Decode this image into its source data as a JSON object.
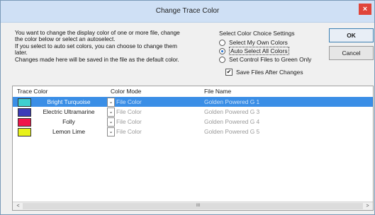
{
  "window": {
    "title": "Change Trace Color",
    "close_label": "×"
  },
  "instructions": [
    "You want to change the display color of one or more file, change",
    "the color below or select an autoselect.",
    "If you select to auto set colors, you can choose to change them",
    "later.",
    "Changes made here will be saved in the file as the default color."
  ],
  "settings": {
    "heading": "Select Color Choice Settings",
    "options": [
      {
        "label": "Select My Own Colors",
        "selected": false
      },
      {
        "label": "Auto Select All Colors",
        "selected": true
      },
      {
        "label": "Set Control Files to Green Only",
        "selected": false
      }
    ],
    "save_files_label": "Save Files After Changes",
    "save_files_checked": true
  },
  "buttons": {
    "ok": "OK",
    "cancel": "Cancel"
  },
  "table": {
    "headers": {
      "color": "Trace Color",
      "mode": "Color Mode",
      "file": "File Name"
    },
    "rows": [
      {
        "color_name": "Bright Turquoise",
        "swatch": "#3fd0cf",
        "mode": "File Color",
        "file": "Golden Powered G 1",
        "selected": true
      },
      {
        "color_name": "Electric Ultramarine",
        "swatch": "#3b3bb8",
        "mode": "File Color",
        "file": "Golden Powered G 3",
        "selected": false
      },
      {
        "color_name": "Folly",
        "swatch": "#f0154a",
        "mode": "File Color",
        "file": "Golden Powered G 4",
        "selected": false
      },
      {
        "color_name": "Lemon Lime",
        "swatch": "#e8f21a",
        "mode": "File Color",
        "file": "Golden Powered G 5",
        "selected": false
      }
    ],
    "scroll": {
      "left_arrow": "<",
      "right_arrow": ">",
      "grip": "III"
    }
  },
  "colors": {
    "selection": "#3a8ee6",
    "titlebar": "#cfe0f5",
    "close": "#e0453a"
  }
}
